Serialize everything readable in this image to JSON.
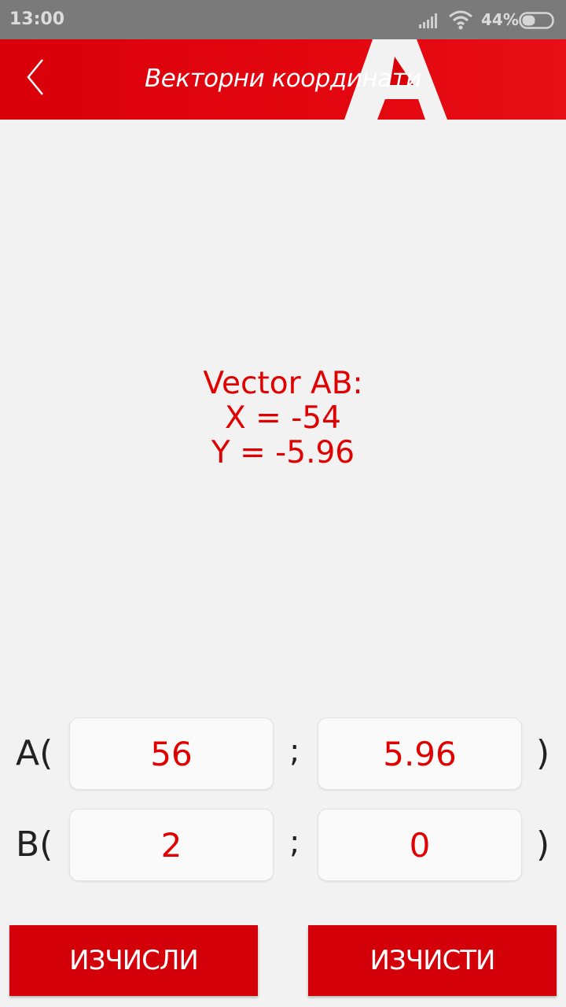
{
  "status_bar": {
    "time": "13:00",
    "battery_percent": "44%",
    "icons": [
      "signal-icon",
      "wifi-icon",
      "battery-icon"
    ]
  },
  "header": {
    "title": "Векторни координати",
    "back_icon": "chevron-left-icon",
    "logo": "A"
  },
  "result": {
    "line1": "Vector AB:",
    "line2": "X = -54",
    "line3": "Y = -5.96"
  },
  "inputs": {
    "a": {
      "label": "A(",
      "x": "56",
      "y": "5.96"
    },
    "b": {
      "label": "B(",
      "x": "2",
      "y": "0"
    },
    "separator": ";",
    "close": ")"
  },
  "buttons": {
    "calculate": "ИЗЧИСЛИ",
    "clear": "ИЗЧИСТИ"
  },
  "colors": {
    "accent": "#d3000a",
    "result_text": "#e00000",
    "background": "#f2f2f2",
    "status_bar": "#7a7a7a"
  }
}
